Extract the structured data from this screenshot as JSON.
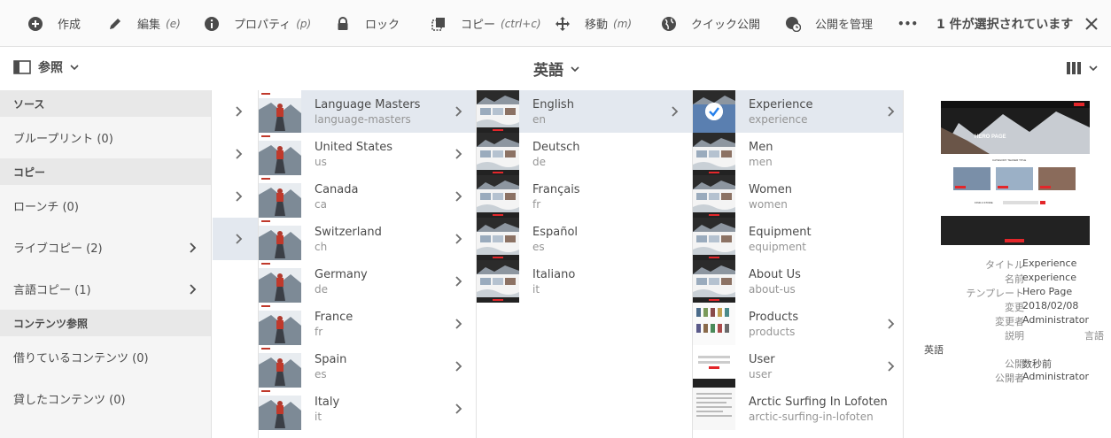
{
  "actionbar": {
    "create": "作成",
    "edit": "編集",
    "edit_hint": "(e)",
    "properties": "プロパティ",
    "properties_hint": "(p)",
    "lock": "ロック",
    "copy": "コピー",
    "copy_hint": "(ctrl+c)",
    "move": "移動",
    "move_hint": "(m)",
    "quick_publish": "クイック公開",
    "manage_publication": "公開を管理",
    "more": "•••",
    "selection_count": "1 件が選択されています"
  },
  "viewbar": {
    "rail_label": "参照",
    "title": "英語"
  },
  "rail": {
    "sections": [
      {
        "header": "ソース",
        "items": [
          {
            "label": "ブループリント (0)",
            "has_chevron": false
          }
        ]
      },
      {
        "header": "コピー",
        "items": [
          {
            "label": "ローンチ (0)",
            "has_chevron": false
          },
          {
            "label": "ライブコピー (2)",
            "has_chevron": true
          },
          {
            "label": "言語コピー (1)",
            "has_chevron": true
          }
        ]
      },
      {
        "header": "コンテンツ参照",
        "items": [
          {
            "label": "借りているコンテンツ (0)",
            "has_chevron": false
          },
          {
            "label": "貸したコンテンツ (0)",
            "has_chevron": false
          }
        ]
      }
    ]
  },
  "columns": {
    "col1": [
      {
        "title": "Language Masters",
        "name": "language-masters",
        "selected": true
      },
      {
        "title": "United States",
        "name": "us"
      },
      {
        "title": "Canada",
        "name": "ca"
      },
      {
        "title": "Switzerland",
        "name": "ch"
      },
      {
        "title": "Germany",
        "name": "de"
      },
      {
        "title": "France",
        "name": "fr"
      },
      {
        "title": "Spain",
        "name": "es"
      },
      {
        "title": "Italy",
        "name": "it"
      }
    ],
    "col2": [
      {
        "title": "English",
        "name": "en",
        "selected": true,
        "chevron": true
      },
      {
        "title": "Deutsch",
        "name": "de"
      },
      {
        "title": "Français",
        "name": "fr"
      },
      {
        "title": "Español",
        "name": "es"
      },
      {
        "title": "Italiano",
        "name": "it"
      }
    ],
    "col3": [
      {
        "title": "Experience",
        "name": "experience",
        "selected": true,
        "chevron": true
      },
      {
        "title": "Men",
        "name": "men"
      },
      {
        "title": "Women",
        "name": "women"
      },
      {
        "title": "Equipment",
        "name": "equipment"
      },
      {
        "title": "About Us",
        "name": "about-us"
      },
      {
        "title": "Products",
        "name": "products",
        "chevron": true
      },
      {
        "title": "User",
        "name": "user",
        "chevron": true
      },
      {
        "title": "Arctic Surfing In Lofoten",
        "name": "arctic-surfing-in-lofoten"
      }
    ]
  },
  "detail": {
    "preview_text": {
      "hero": "HERO PAGE",
      "category": "CATEGORY TEASER TITLE",
      "find_store": "FIND A STORE"
    },
    "fields": [
      {
        "label": "タイトル",
        "value": "Experience"
      },
      {
        "label": "名前",
        "value": "experience"
      },
      {
        "label": "テンプレート",
        "value": "Hero Page"
      },
      {
        "label": "変更",
        "value": "2018/02/08"
      },
      {
        "label": "変更者",
        "value": "Administrator"
      },
      {
        "label": "説明",
        "value": ""
      }
    ],
    "language_label": "言語",
    "language_value": "英語",
    "fields2": [
      {
        "label": "公開",
        "value": "数秒前"
      },
      {
        "label": "公開者",
        "value": "Administrator"
      }
    ]
  },
  "colors": {
    "selected_row": "#e3e8ef",
    "rail_bg": "#f5f5f5",
    "accent_red": "#e3262a",
    "selected_check": "#2680eb"
  }
}
